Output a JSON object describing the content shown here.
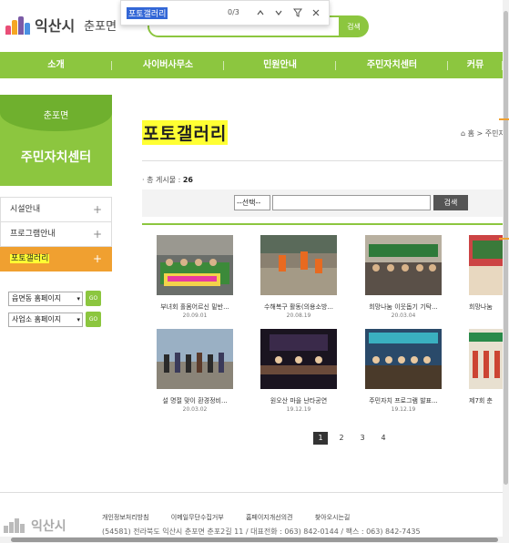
{
  "header": {
    "logo_text": "익산시",
    "logo_sub": "춘포면",
    "search_button": "검색"
  },
  "findbar": {
    "query": "포토갤러리",
    "count": "0/3",
    "prev_icon": "chevron-up-icon",
    "next_icon": "chevron-down-icon",
    "filter_icon": "filter-icon",
    "close_icon": "close-icon"
  },
  "nav": {
    "items": [
      {
        "label": "소개"
      },
      {
        "label": "사이버사무소"
      },
      {
        "label": "민원안내"
      },
      {
        "label": "주민자치센터"
      },
      {
        "label": "커뮤"
      }
    ]
  },
  "sidebar": {
    "dong": "춘포면",
    "title": "주민자치센터",
    "items": [
      {
        "label": "시설안내"
      },
      {
        "label": "프로그램안내"
      },
      {
        "label": "포토갤러리"
      }
    ],
    "quick": [
      {
        "label": "읍면동 홈페이지",
        "go": "GO"
      },
      {
        "label": "사업소 홈페이지",
        "go": "GO"
      }
    ]
  },
  "main": {
    "title": "포토갤러리",
    "breadcrumb": "홈 > 주민자",
    "total_label": "· 총 게시물 :",
    "total_count": "26",
    "search_select": "--선택--",
    "search_button": "검색"
  },
  "gallery": [
    {
      "caption": "부녀회 홀몸어르신 밑반...",
      "date": "20.09.01"
    },
    {
      "caption": "수해복구 활동(의용소방...",
      "date": "20.08.19"
    },
    {
      "caption": "희망나눔 이웃돕기 기탁...",
      "date": "20.03.04"
    },
    {
      "caption": "희망나눔",
      "date": ""
    },
    {
      "caption": "설 명절 맞이 환경정비...",
      "date": "20.03.02"
    },
    {
      "caption": "원오산 마을 난타공연",
      "date": "19.12.19"
    },
    {
      "caption": "주민자치 프로그램 발표...",
      "date": "19.12.19"
    },
    {
      "caption": "제7회 춘",
      "date": ""
    }
  ],
  "pagination": [
    "1",
    "2",
    "3",
    "4"
  ],
  "footer": {
    "logo_text": "익산시",
    "links": [
      "개인정보처리방침",
      "이메일무단수집거부",
      "홈페이지개선의견",
      "찾아오시는길"
    ],
    "address": "(54581) 전라북도 익산시 춘포면 춘포2길 11 / 대표전화 : 063) 842-0144 / 팩스 : 063) 842-7435"
  },
  "colors": {
    "brand_green": "#8cc63f",
    "active_orange": "#f0a030",
    "highlight": "#ffff33"
  }
}
